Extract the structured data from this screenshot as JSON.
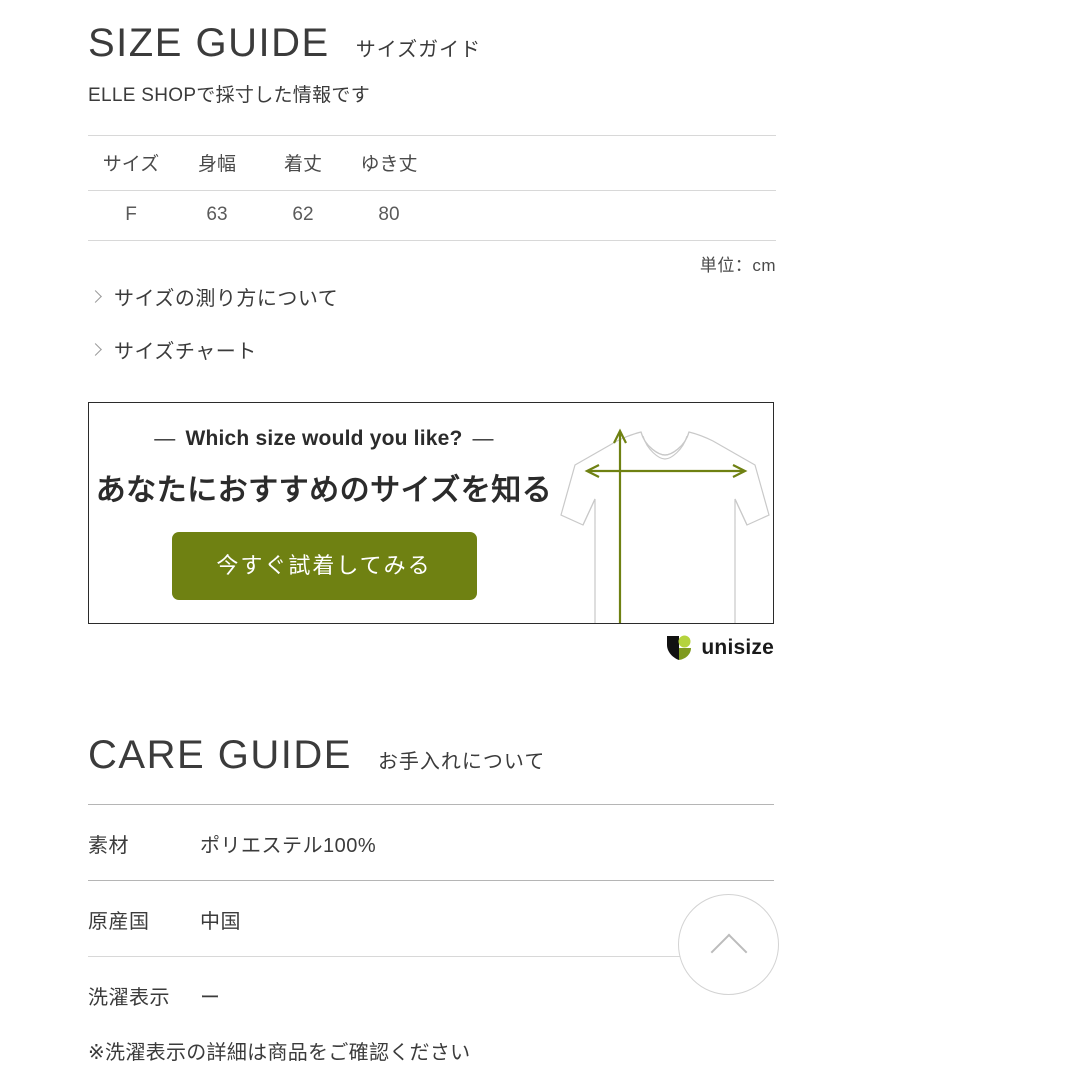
{
  "size_guide": {
    "title_en": "SIZE GUIDE",
    "title_jp": "サイズガイド",
    "lead": "ELLE SHOPで採寸した情報です",
    "table": {
      "headers": [
        "サイズ",
        "身幅",
        "着丈",
        "ゆき丈"
      ],
      "rows": [
        [
          "F",
          "63",
          "62",
          "80"
        ]
      ]
    },
    "unit_note": "単位：cm",
    "links": [
      {
        "label": "サイズの測り方について",
        "icon": "chevron-right-icon"
      },
      {
        "label": "サイズチャート",
        "icon": "chevron-right-icon"
      }
    ]
  },
  "promo": {
    "kicker_dash_left": "—",
    "kicker": "Which size would you like?",
    "kicker_dash_right": "—",
    "headline": "あなたにおすすめのサイズを知る",
    "button_label": "今すぐ試着してみる",
    "button_color": "#6f8112",
    "arrow_color": "#6f8112",
    "shirt_outline_color": "#c9c9c9",
    "border_color": "#2b2b2b",
    "brand": {
      "name": "unisize",
      "mark_dark": "#111111",
      "mark_green": "#b5d33d"
    }
  },
  "care_guide": {
    "title_en": "CARE GUIDE",
    "title_jp": "お手入れについて",
    "rows": [
      {
        "key": "素材",
        "value": "ポリエステル100%"
      },
      {
        "key": "原産国",
        "value": "中国"
      },
      {
        "key": "洗濯表示",
        "value": "ー"
      }
    ],
    "note": "※洗濯表示の詳細は商品をご確認ください"
  },
  "back_to_top": {
    "icon": "chevron-up-icon",
    "label": ""
  }
}
